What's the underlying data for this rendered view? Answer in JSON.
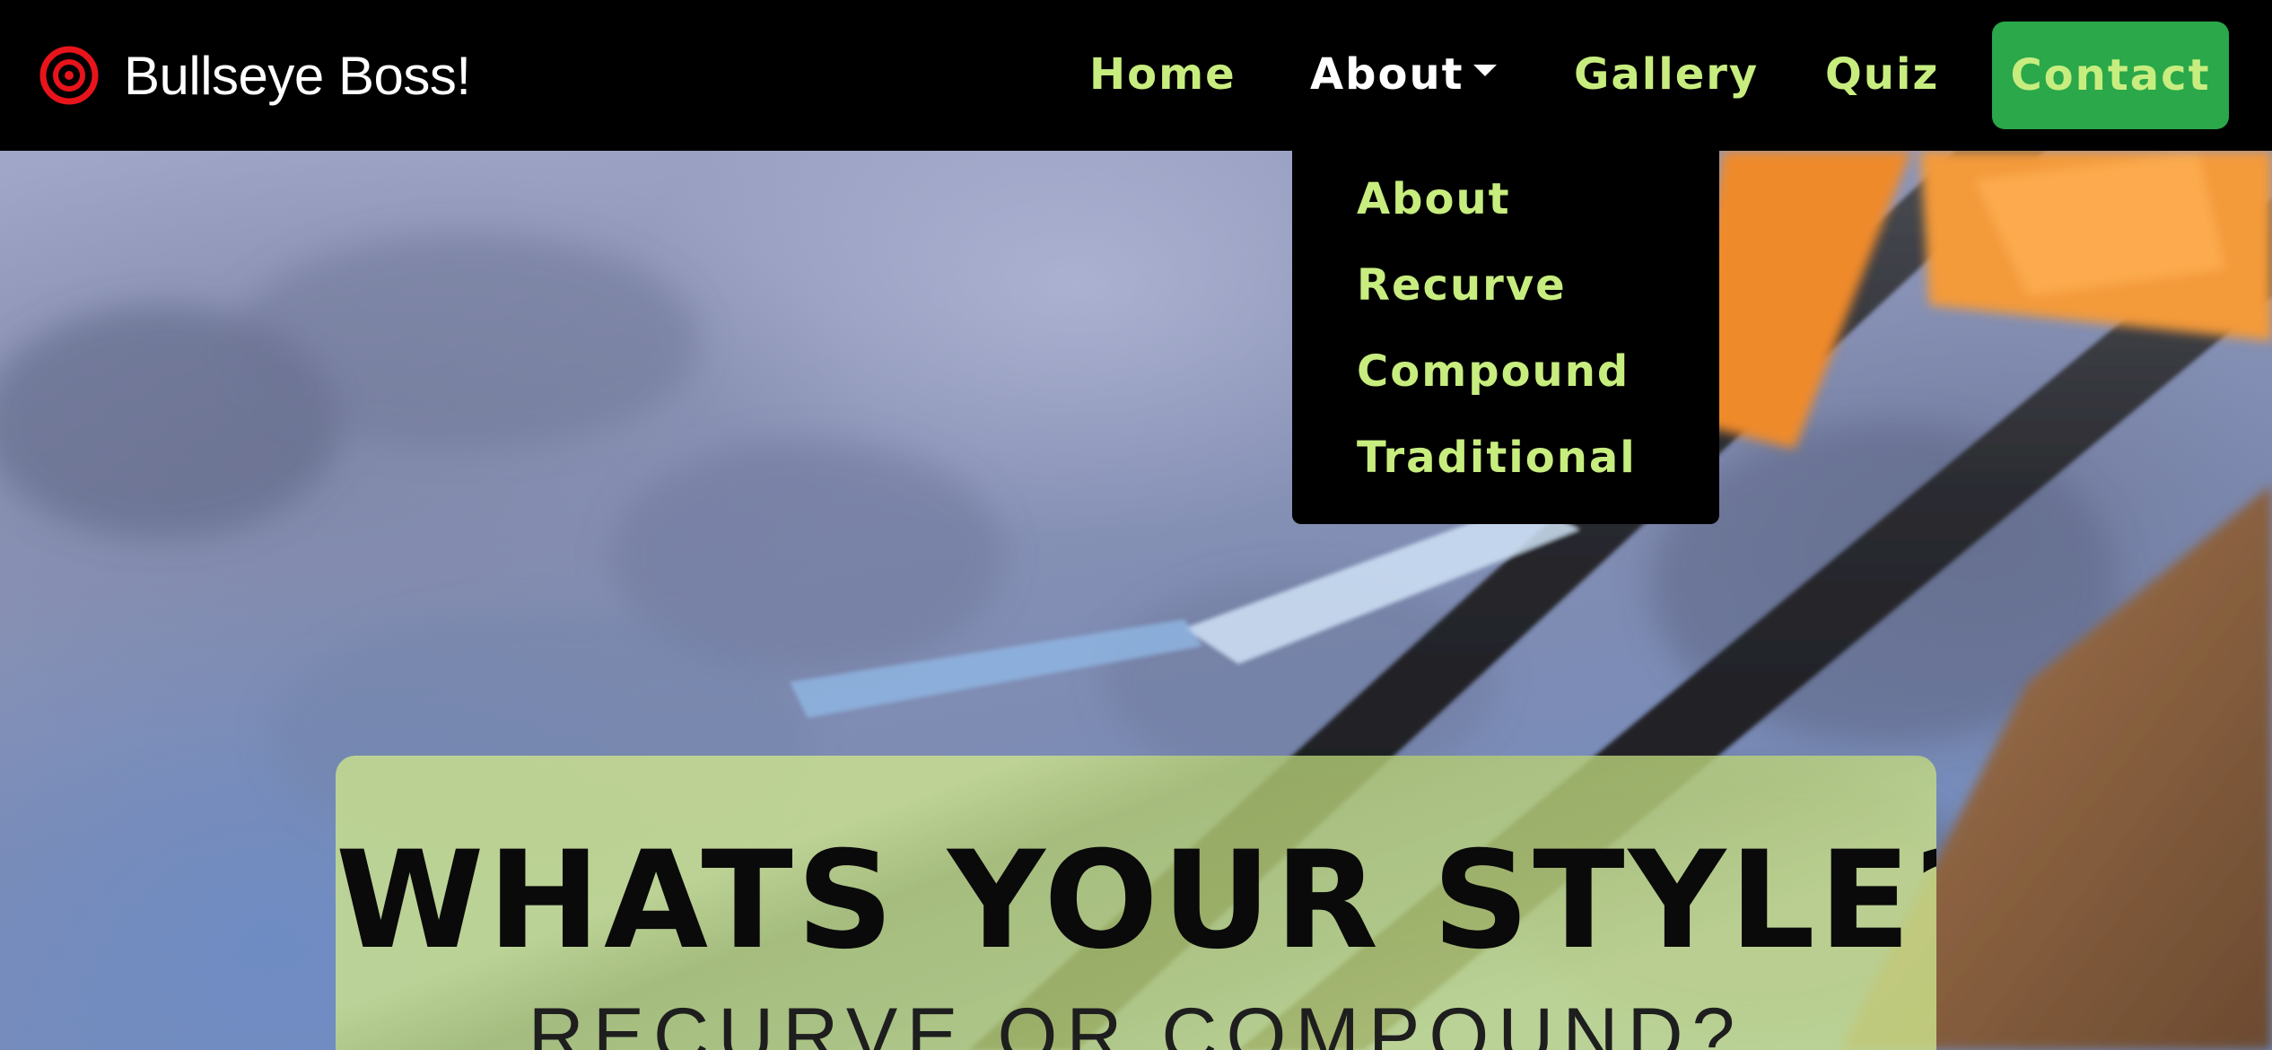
{
  "brand": {
    "name": "Bullseye Boss!",
    "icon": "bullseye-target-icon",
    "icon_color": "#e8141b"
  },
  "nav": {
    "items": [
      {
        "label": "Home"
      },
      {
        "label": "About",
        "has_dropdown": true,
        "active": true
      },
      {
        "label": "Gallery"
      },
      {
        "label": "Quiz"
      }
    ],
    "contact_label": "Contact",
    "link_color": "#c8ed7f",
    "active_color": "#ffffff",
    "contact_bg": "#2aa84a"
  },
  "dropdown": {
    "items": [
      {
        "label": "About"
      },
      {
        "label": "Recurve"
      },
      {
        "label": "Compound"
      },
      {
        "label": "Traditional"
      }
    ]
  },
  "hero": {
    "title": "WHATS YOUR STYLE?",
    "subtitle": "RECURVE OR COMPOUND?",
    "card_color": "#cde48c"
  }
}
